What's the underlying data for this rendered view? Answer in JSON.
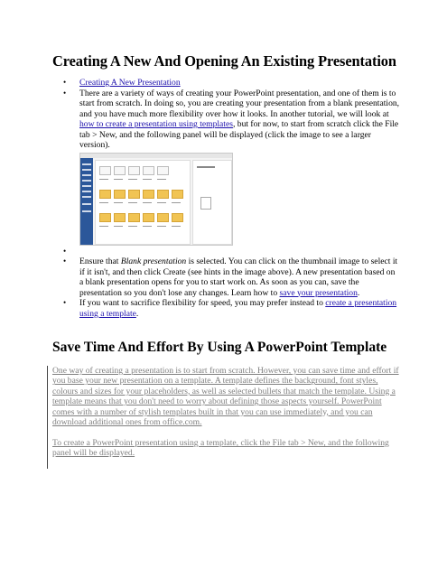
{
  "title": "Creating A New And Opening An Existing Presentation",
  "list": {
    "item1_link": "Creating A New Presentation",
    "item2_a": "There are a variety of ways of creating your PowerPoint presentation, and one of them is to start from scratch. In doing so, you are creating your presentation from a blank presentation, and you have much more flexibility over how it looks. In another tutorial, we will look at ",
    "item2_link": "how to create a presentation using templates",
    "item2_b": ", but for now, to start from scratch click the File tab > New, and the following panel will be displayed (click the image to see a larger version).",
    "item4_a": "Ensure that ",
    "item4_em": "Blank presentation",
    "item4_b": " is selected. You can click on the thumbnail image to select it if it isn't, and then click Create (see hints in the image above). A new presentation based on a blank presentation opens for you to start work on. As soon as you can, save the presentation so you don't lose any changes. Learn how to ",
    "item4_link": "save your presentation",
    "item4_c": ".",
    "item5_a": "If you want to sacrifice flexibility for speed, you may prefer instead to ",
    "item5_link": "create a presentation using a template",
    "item5_b": "."
  },
  "section2_title": "Save Time And Effort By Using A PowerPoint Template",
  "para1": "One way of creating a presentation is to start from scratch. However, you can save time and effort if you base your new presentation on a template. A template defines the background, font styles, colours and sizes for your placeholders, as well as selected bullets that match the template. Using a template means that you don't need to worry about defining those aspects yourself. PowerPoint comes with a number of stylish templates built in that you can use immediately, and you can download additional ones from office.com.",
  "para2": "To create a PowerPoint presentation using a template, click the File tab > New, and the following panel will be displayed."
}
